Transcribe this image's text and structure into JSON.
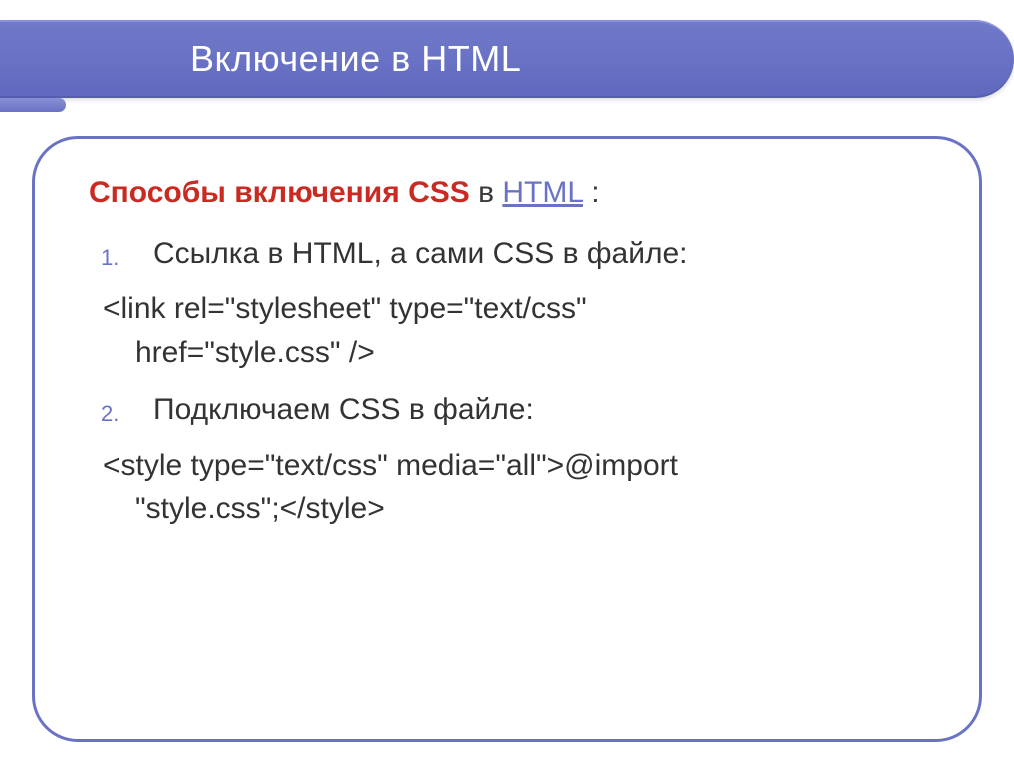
{
  "slide": {
    "title": "Включение в HTML",
    "heading": {
      "lead": "Способы включения CSS",
      "suffix": " в ",
      "link": "HTML",
      "tail": " :"
    },
    "items": {
      "one": {
        "label": "Ссылка в HTML, а сами CSS в файле:",
        "code_line1": "<link rel=\"stylesheet\" type=\"text/css\"",
        "code_line2": "href=\"style.css\" />"
      },
      "two": {
        "label": "Подключаем CSS в файле:",
        "code_line1": "<style type=\"text/css\" media=\"all\">@import",
        "code_line2": "\"style.css\";</style>"
      }
    }
  }
}
